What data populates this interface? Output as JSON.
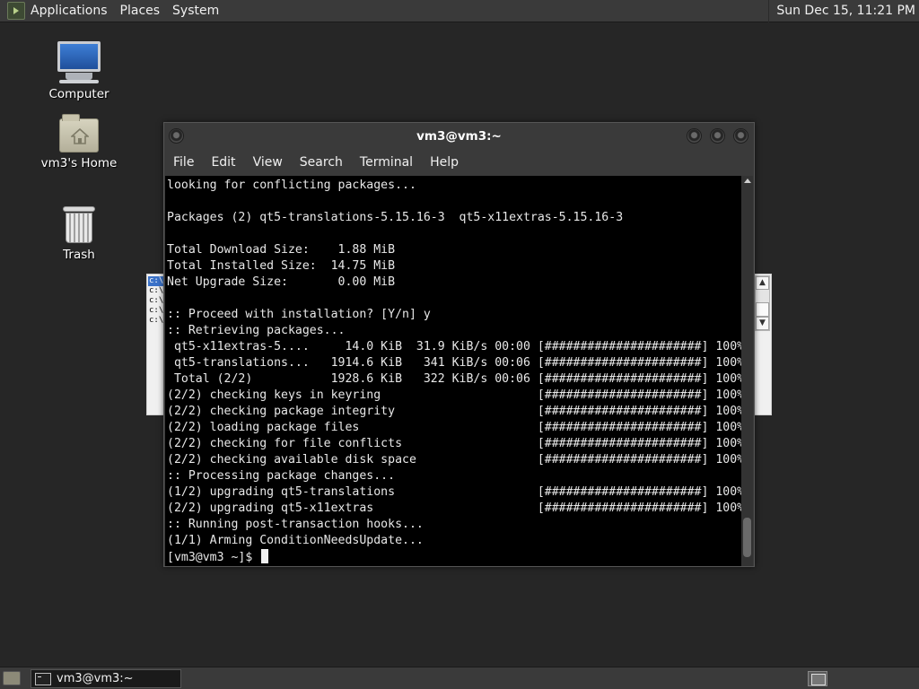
{
  "top_panel": {
    "menus": [
      "Applications",
      "Places",
      "System"
    ],
    "clock": "Sun Dec 15, 11:21 PM",
    "logo_icon": "distro-menu-icon"
  },
  "desktop": {
    "icons": [
      {
        "label": "Computer",
        "icon": "computer-icon"
      },
      {
        "label": "vm3's Home",
        "icon": "home-folder-icon"
      },
      {
        "label": "Trash",
        "icon": "trash-icon"
      }
    ]
  },
  "background_window": {
    "list_items": [
      "c:\\",
      "c:\\",
      "c:\\",
      "c:\\",
      "c:\\"
    ]
  },
  "terminal": {
    "title": "vm3@vm3:~",
    "menus": [
      "File",
      "Edit",
      "View",
      "Search",
      "Terminal",
      "Help"
    ],
    "lines": [
      "looking for conflicting packages...",
      "",
      "Packages (2) qt5-translations-5.15.16-3  qt5-x11extras-5.15.16-3",
      "",
      "Total Download Size:    1.88 MiB",
      "Total Installed Size:  14.75 MiB",
      "Net Upgrade Size:       0.00 MiB",
      "",
      ":: Proceed with installation? [Y/n] y",
      ":: Retrieving packages...",
      " qt5-x11extras-5....     14.0 KiB  31.9 KiB/s 00:00 [######################] 100%",
      " qt5-translations...   1914.6 KiB   341 KiB/s 00:06 [######################] 100%",
      " Total (2/2)           1928.6 KiB   322 KiB/s 00:06 [######################] 100%",
      "(2/2) checking keys in keyring                      [######################] 100%",
      "(2/2) checking package integrity                    [######################] 100%",
      "(2/2) loading package files                         [######################] 100%",
      "(2/2) checking for file conflicts                   [######################] 100%",
      "(2/2) checking available disk space                 [######################] 100%",
      ":: Processing package changes...",
      "(1/2) upgrading qt5-translations                    [######################] 100%",
      "(2/2) upgrading qt5-x11extras                       [######################] 100%",
      ":: Running post-transaction hooks...",
      "(1/1) Arming ConditionNeedsUpdate..."
    ],
    "prompt": "[vm3@vm3 ~]$ "
  },
  "bottom_panel": {
    "task_label": "vm3@vm3:~"
  }
}
